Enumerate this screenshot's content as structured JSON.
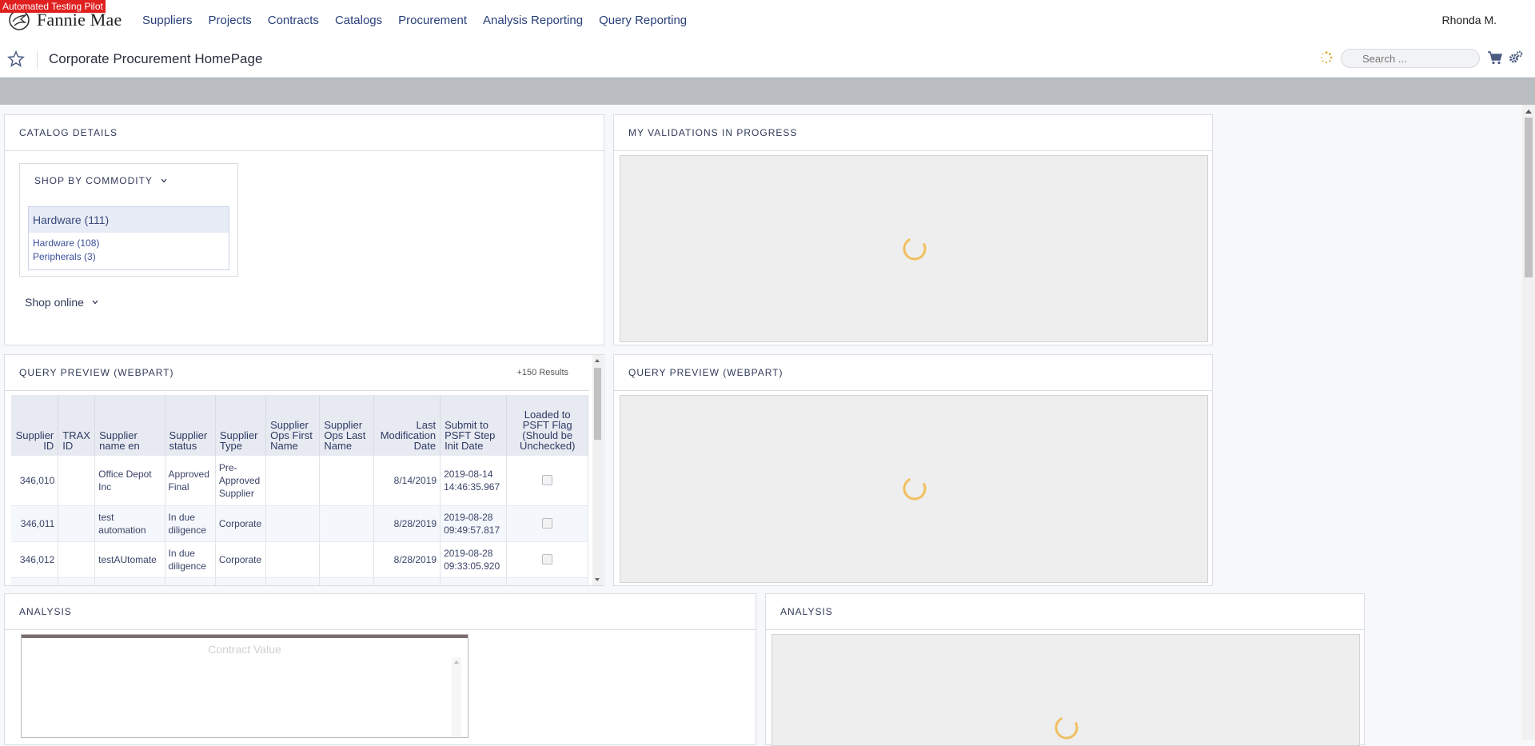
{
  "badge": "Automated Testing Pilot",
  "brand": "Fannie Mae",
  "nav": [
    "Suppliers",
    "Projects",
    "Contracts",
    "Catalogs",
    "Procurement",
    "Analysis Reporting",
    "Query Reporting"
  ],
  "user": "Rhonda M.",
  "page_title": "Corporate Procurement HomePage",
  "search_placeholder": "Search ...",
  "catalog": {
    "title": "CATALOG DETAILS",
    "shop_by": "SHOP BY COMMODITY",
    "top": "Hardware (111)",
    "items": [
      "Hardware (108)",
      "Peripherals (3)"
    ],
    "shop_online": "Shop online"
  },
  "validations_title": "MY VALIDATIONS IN PROGRESS",
  "query_left": {
    "title": "QUERY PREVIEW (WEBPART)",
    "results": "+150 Results",
    "columns": [
      "Supplier ID",
      "TRAX ID",
      "Supplier name en",
      "Supplier status",
      "Supplier Type",
      "Supplier Ops First Name",
      "Supplier Ops Last Name",
      "Last Modification Date",
      "Submit to PSFT Step Init Date",
      "Loaded to PSFT Flag (Should be Unchecked)"
    ],
    "rows": [
      [
        "346,010",
        "",
        "Office Depot Inc",
        "Approved Final",
        "Pre-Approved Supplier",
        "",
        "",
        "8/14/2019",
        "2019-08-14 14:46:35.967"
      ],
      [
        "346,011",
        "",
        "test automation",
        "In due diligence",
        "Corporate",
        "",
        "",
        "8/28/2019",
        "2019-08-28 09:49:57.817"
      ],
      [
        "346,012",
        "",
        "testAUtomate",
        "In due diligence",
        "Corporate",
        "",
        "",
        "8/28/2019",
        "2019-08-28 09:33:05.920"
      ]
    ]
  },
  "query_right_title": "QUERY PREVIEW (WEBPART)",
  "analysis_left": {
    "title": "ANALYSIS",
    "chart_title": "Contract Value"
  },
  "analysis_right_title": "ANALYSIS"
}
